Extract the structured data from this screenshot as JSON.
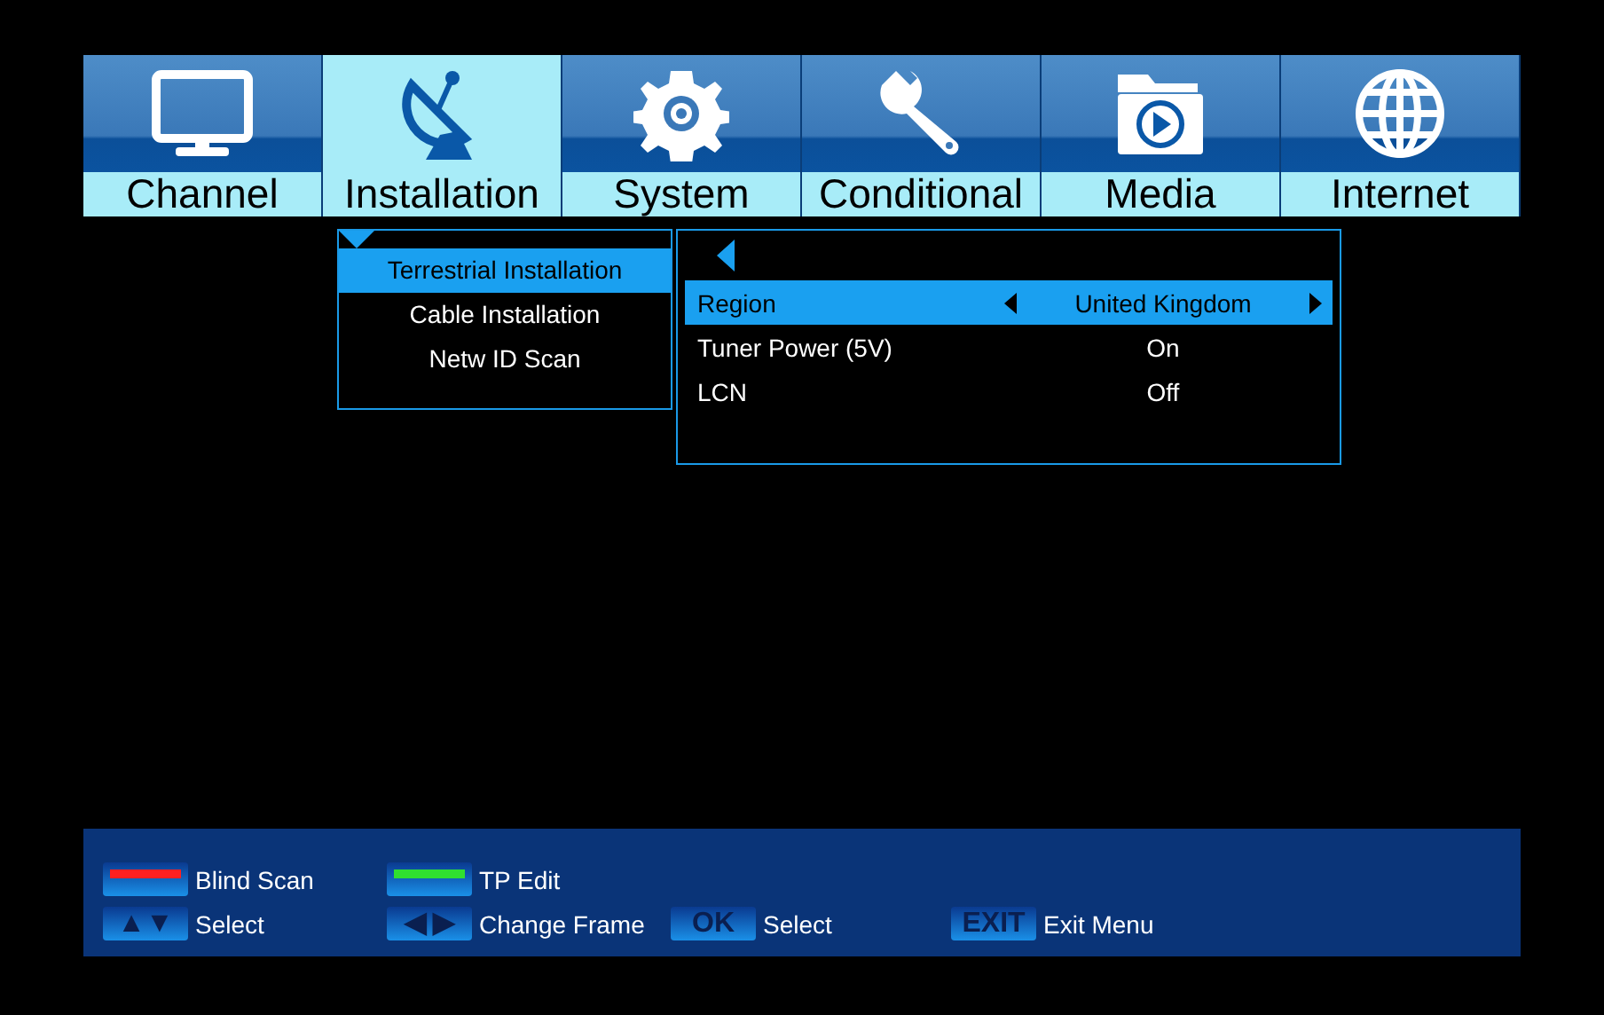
{
  "tabs": [
    {
      "label": "Channel",
      "kind": "tv",
      "selected": false
    },
    {
      "label": "Installation",
      "kind": "dish",
      "selected": true
    },
    {
      "label": "System",
      "kind": "gear",
      "selected": false
    },
    {
      "label": "Conditional",
      "kind": "wrench",
      "selected": false
    },
    {
      "label": "Media",
      "kind": "media",
      "selected": false
    },
    {
      "label": "Internet",
      "kind": "globe",
      "selected": false
    }
  ],
  "submenu": [
    {
      "label": "Terrestrial Installation",
      "selected": true
    },
    {
      "label": "Cable Installation",
      "selected": false
    },
    {
      "label": "Netw ID Scan",
      "selected": false
    }
  ],
  "settings": [
    {
      "label": "Region",
      "value": "United Kingdom",
      "selected": true
    },
    {
      "label": "Tuner Power (5V)",
      "value": "On",
      "selected": false
    },
    {
      "label": "LCN",
      "value": "Off",
      "selected": false
    }
  ],
  "footer": [
    [
      {
        "kind": "color",
        "color": "#ff2020",
        "label": "Blind Scan"
      },
      {
        "kind": "color",
        "color": "#30e030",
        "label": "TP Edit"
      }
    ],
    [
      {
        "kind": "arrows",
        "key": "▲▼",
        "label": "Select"
      },
      {
        "kind": "arrows",
        "key": "◀ ▶",
        "label": "Change Frame"
      },
      {
        "kind": "text",
        "key": "OK",
        "label": "Select"
      },
      {
        "kind": "text",
        "key": "EXIT",
        "label": "Exit Menu"
      }
    ]
  ]
}
